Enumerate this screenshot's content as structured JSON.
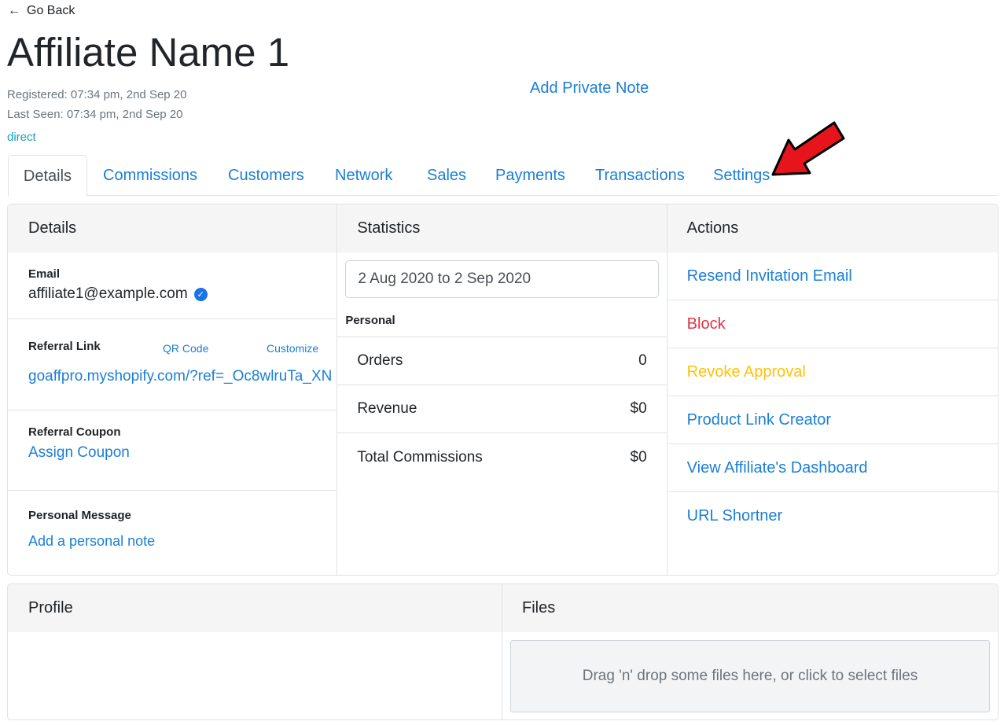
{
  "nav": {
    "back_label": "Go Back"
  },
  "affiliate": {
    "name": "Affiliate Name 1",
    "registered": "Registered: 07:34 pm, 2nd Sep 20",
    "last_seen": "Last Seen: 07:34 pm, 2nd Sep 20",
    "source": "direct",
    "private_note_label": "Add Private Note"
  },
  "tabs": [
    {
      "label": "Details",
      "active": true
    },
    {
      "label": "Commissions"
    },
    {
      "label": "Customers"
    },
    {
      "label": "Network"
    },
    {
      "label": "Sales"
    },
    {
      "label": "Payments"
    },
    {
      "label": "Transactions"
    },
    {
      "label": "Settings"
    }
  ],
  "details": {
    "header": "Details",
    "email_label": "Email",
    "email": "affiliate1@example.com",
    "referral_link_label": "Referral Link",
    "qr_code_label": "QR Code",
    "customize_label": "Customize",
    "referral_link": "goaffpro.myshopify.com/?ref=_Oc8wlruTa_XN",
    "referral_coupon_label": "Referral Coupon",
    "assign_coupon_label": "Assign Coupon",
    "personal_message_label": "Personal Message",
    "add_note_label": "Add a personal note"
  },
  "statistics": {
    "header": "Statistics",
    "date_range": "2 Aug 2020 to 2 Sep 2020",
    "section_label": "Personal",
    "rows": [
      {
        "label": "Orders",
        "value": "0"
      },
      {
        "label": "Revenue",
        "value": "$0"
      },
      {
        "label": "Total Commissions",
        "value": "$0"
      }
    ]
  },
  "actions": {
    "header": "Actions",
    "items": [
      {
        "label": "Resend Invitation Email",
        "color": "#1a7fd6"
      },
      {
        "label": "Block",
        "color": "#dc3545"
      },
      {
        "label": "Revoke Approval",
        "color": "#ffc107"
      },
      {
        "label": "Product Link Creator",
        "color": "#1a7fd6"
      },
      {
        "label": "View Affiliate's Dashboard",
        "color": "#1a7fd6"
      },
      {
        "label": "URL Shortner",
        "color": "#1a7fd6"
      }
    ]
  },
  "profile": {
    "header": "Profile"
  },
  "files": {
    "header": "Files",
    "dropzone_text": "Drag 'n' drop some files here, or click to select files"
  },
  "colors": {
    "link": "#1a7fd6",
    "danger": "#dc3545",
    "warning": "#ffc107",
    "info": "#17a2b8",
    "annotation_arrow": "#e8141c"
  }
}
